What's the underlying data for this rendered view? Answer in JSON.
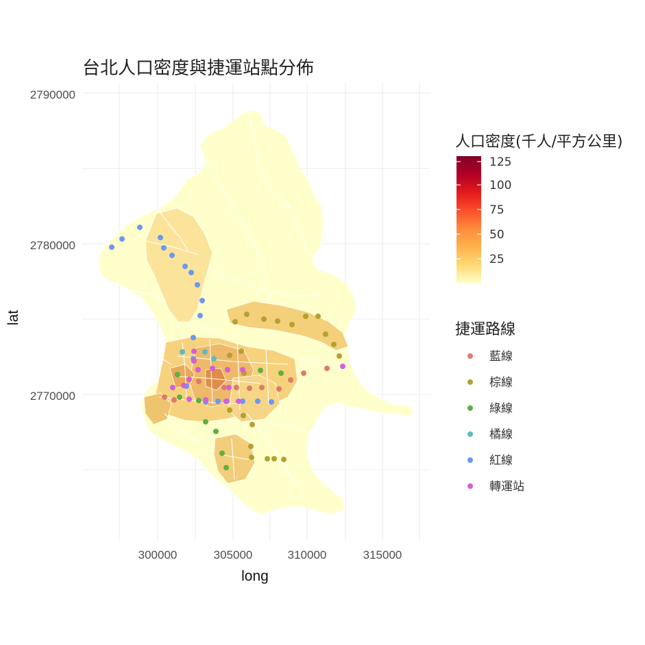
{
  "title": "台北人口密度與捷運站點分佈",
  "axes": {
    "xlabel": "long",
    "ylabel": "lat",
    "x_ticks": [
      "300000",
      "305000",
      "310000",
      "315000"
    ],
    "y_ticks": [
      "2790000",
      "2780000",
      "2770000"
    ]
  },
  "legend_density": {
    "title": "人口密度(千人/平方公里)",
    "ticks": [
      "125",
      "100",
      "75",
      "50",
      "25"
    ],
    "colors": [
      "#ffffcc",
      "#fed976",
      "#feb24c",
      "#fd8d3c",
      "#fc4e2a",
      "#e31a1c",
      "#b10026",
      "#800026"
    ]
  },
  "legend_lines": {
    "title": "捷運路線",
    "items": [
      {
        "label": "藍線",
        "color": "#e07b6a"
      },
      {
        "label": "棕線",
        "color": "#b3a130"
      },
      {
        "label": "綠線",
        "color": "#5cb040"
      },
      {
        "label": "橘線",
        "color": "#5bbbc0"
      },
      {
        "label": "紅線",
        "color": "#6b98f0"
      },
      {
        "label": "轉運站",
        "color": "#d45fd8"
      }
    ]
  },
  "map": {
    "background_fill": "#ffffcc",
    "border_color": "#ffffff"
  }
}
